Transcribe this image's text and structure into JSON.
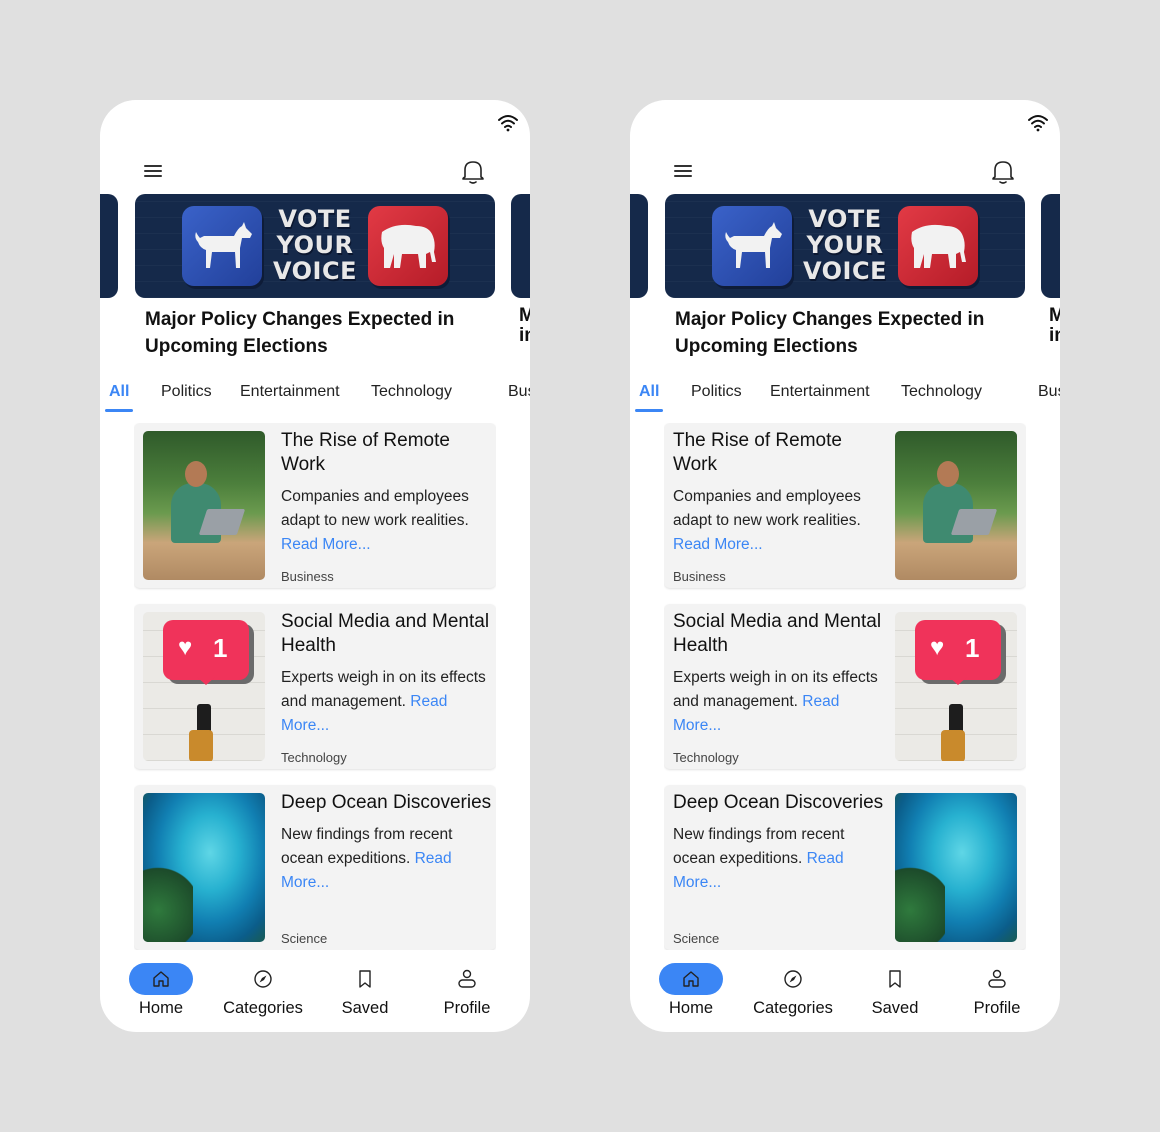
{
  "phones": [
    {
      "id": "left",
      "card_layout": "image-left",
      "status_bar": {
        "wifi_icon": "wifi-icon"
      },
      "header": {
        "menu_icon": "hamburger-menu-icon",
        "notification_icon": "bell-icon"
      },
      "featured": {
        "image_text": [
          "VOTE",
          "YOUR",
          "VOICE"
        ],
        "headline": "Major Policy Changes Expected in Upcoming Elections",
        "next_headline_peek": "M\nir"
      },
      "tabs": [
        {
          "label": "All",
          "active": true
        },
        {
          "label": "Politics",
          "active": false
        },
        {
          "label": "Entertainment",
          "active": false
        },
        {
          "label": "Technology",
          "active": false
        },
        {
          "label": "Bus",
          "active": false
        }
      ],
      "articles": [
        {
          "title": "The Rise of Remote Work",
          "description": "Companies and employees adapt to new work realities.",
          "read_more": "Read More...",
          "category": "Business"
        },
        {
          "title": "Social Media and Mental Health",
          "description": "Experts weigh in on its effects and management.",
          "read_more": "Read More...",
          "category": "Technology"
        },
        {
          "title": "Deep Ocean Discoveries",
          "description": "New findings from recent ocean expeditions.",
          "read_more": "Read More...",
          "category": "Science"
        }
      ],
      "bottom_nav": [
        {
          "label": "Home",
          "icon": "home-icon",
          "active": true
        },
        {
          "label": "Categories",
          "icon": "compass-icon",
          "active": false
        },
        {
          "label": "Saved",
          "icon": "bookmark-icon",
          "active": false
        },
        {
          "label": "Profile",
          "icon": "user-icon",
          "active": false
        }
      ]
    },
    {
      "id": "right",
      "card_layout": "image-right",
      "status_bar": {
        "wifi_icon": "wifi-icon"
      },
      "header": {
        "menu_icon": "hamburger-menu-icon",
        "notification_icon": "bell-icon"
      },
      "featured": {
        "image_text": [
          "VOTE",
          "YOUR",
          "VOICE"
        ],
        "headline": "Major Policy Changes Expected in Upcoming Elections",
        "next_headline_peek": "M\nir"
      },
      "tabs": [
        {
          "label": "All",
          "active": true
        },
        {
          "label": "Politics",
          "active": false
        },
        {
          "label": "Entertainment",
          "active": false
        },
        {
          "label": "Technology",
          "active": false
        },
        {
          "label": "Bus",
          "active": false
        }
      ],
      "articles": [
        {
          "title": "The Rise of Remote Work",
          "description": "Companies and employees adapt to new work realities.",
          "read_more": "Read More...",
          "category": "Business"
        },
        {
          "title": "Social Media and Mental Health",
          "description": "Experts weigh in on its effects and management.",
          "read_more": "Read More...",
          "category": "Technology"
        },
        {
          "title": "Deep Ocean Discoveries",
          "description": "New findings from recent ocean expeditions.",
          "read_more": "Read More...",
          "category": "Science"
        }
      ],
      "bottom_nav": [
        {
          "label": "Home",
          "icon": "home-icon",
          "active": true
        },
        {
          "label": "Categories",
          "icon": "compass-icon",
          "active": false
        },
        {
          "label": "Saved",
          "icon": "bookmark-icon",
          "active": false
        },
        {
          "label": "Profile",
          "icon": "user-icon",
          "active": false
        }
      ]
    }
  ],
  "colors": {
    "accent": "#3b86f5",
    "banner": "#15294a",
    "card": "#f3f3f3",
    "background": "#e0e0e0"
  }
}
